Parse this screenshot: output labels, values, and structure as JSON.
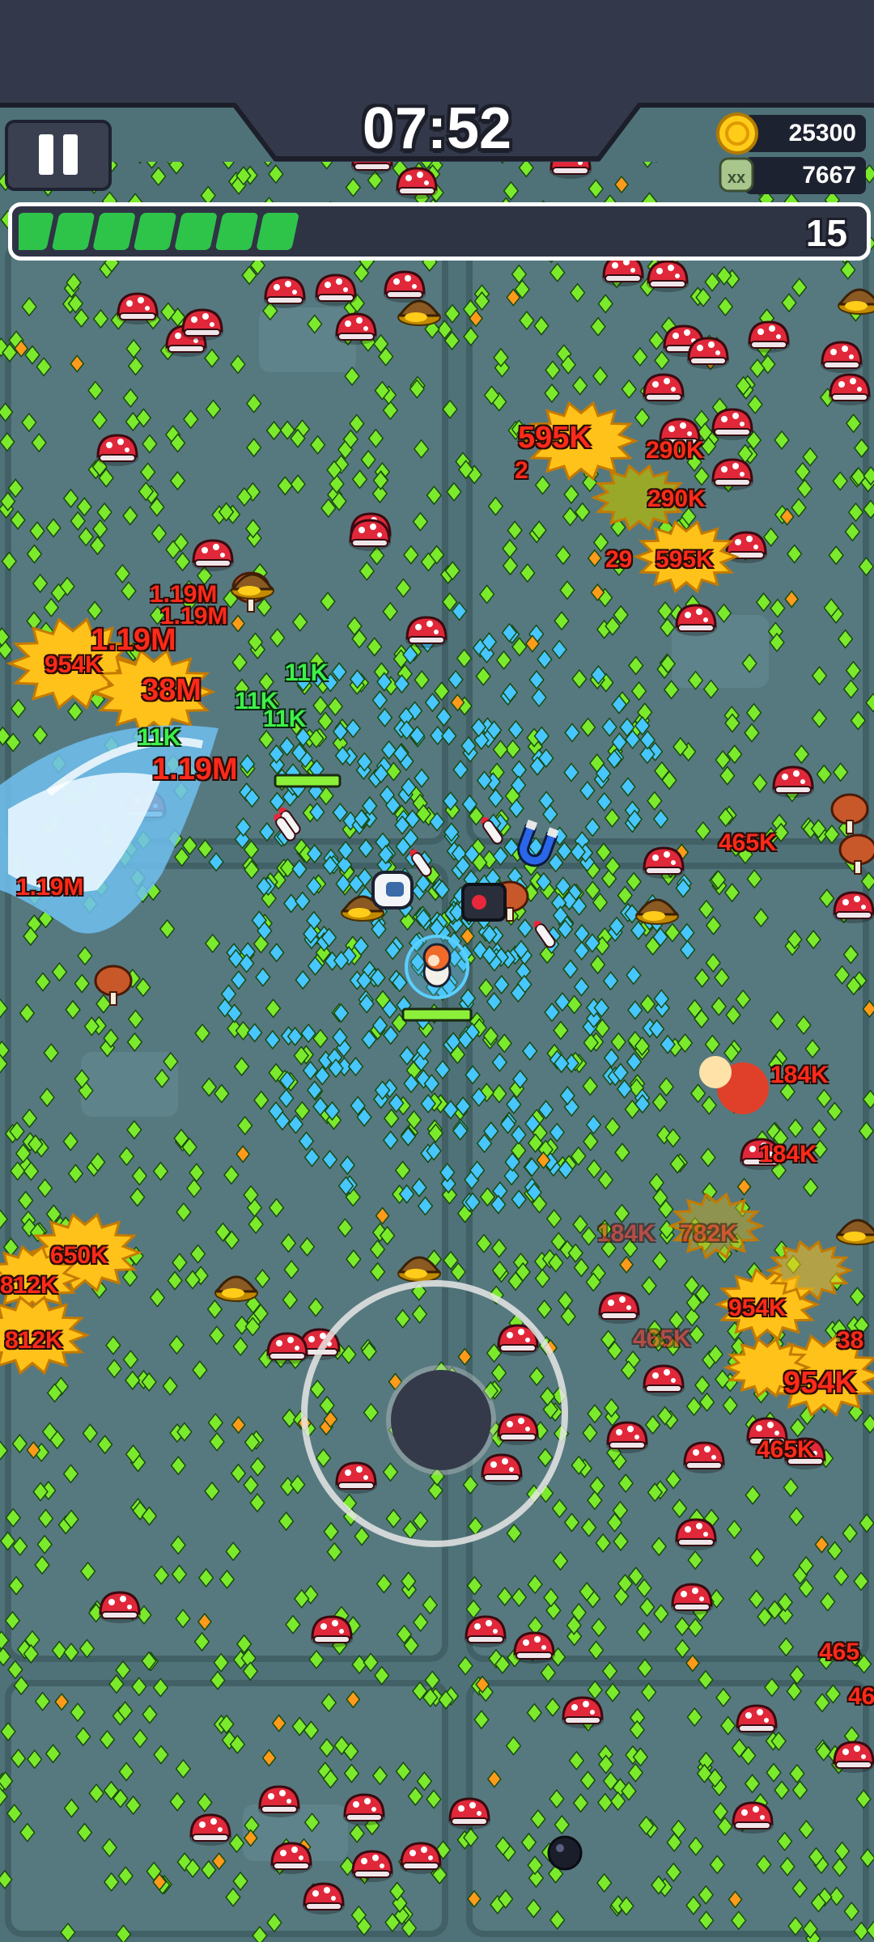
{
  "hud": {
    "timer": "07:52",
    "coins": "25300",
    "kills": "7667",
    "level": "15",
    "xp_progress": 0.33,
    "icons": {
      "pause": "pause-icon",
      "coin": "coin-icon",
      "kills": "skull-icon"
    }
  },
  "damage_numbers": [
    {
      "text": "595K",
      "size": "big"
    },
    {
      "text": "290K",
      "size": "normal"
    },
    {
      "text": "2",
      "size": "normal"
    },
    {
      "text": "290K",
      "size": "normal"
    },
    {
      "text": "29",
      "size": "normal"
    },
    {
      "text": "595K",
      "size": "normal"
    },
    {
      "text": "1.19M",
      "size": "normal"
    },
    {
      "text": "1.19M",
      "size": "normal"
    },
    {
      "text": "1.19M",
      "size": "big"
    },
    {
      "text": "954K",
      "size": "normal"
    },
    {
      "text": "38M",
      "size": "big"
    },
    {
      "text": "1.19M",
      "size": "big"
    },
    {
      "text": "1.19M",
      "size": "normal"
    },
    {
      "text": "11K",
      "size": "green"
    },
    {
      "text": "11K",
      "size": "green"
    },
    {
      "text": "11K",
      "size": "green"
    },
    {
      "text": "11K",
      "size": "green"
    },
    {
      "text": "465K",
      "size": "normal"
    },
    {
      "text": "184K",
      "size": "normal"
    },
    {
      "text": "184K",
      "size": "normal"
    },
    {
      "text": "184K",
      "size": "dim"
    },
    {
      "text": "782K",
      "size": "dim"
    },
    {
      "text": "650K",
      "size": "normal"
    },
    {
      "text": "812K",
      "size": "normal"
    },
    {
      "text": "812K",
      "size": "normal"
    },
    {
      "text": "954K",
      "size": "normal"
    },
    {
      "text": "954K",
      "size": "big"
    },
    {
      "text": "465K",
      "size": "dim"
    },
    {
      "text": "465K",
      "size": "normal"
    },
    {
      "text": "38",
      "size": "normal"
    },
    {
      "text": "465",
      "size": "normal"
    },
    {
      "text": "46",
      "size": "normal"
    }
  ],
  "colors": {
    "floor": "#4f7279",
    "hud_dark": "#33384a",
    "xp_fill": "#2ec44a",
    "gem_green": "#7bea2c",
    "gem_blue": "#47c6ff",
    "damage_red": "#ff2a1a",
    "burst_yellow": "#ffcf1a"
  }
}
